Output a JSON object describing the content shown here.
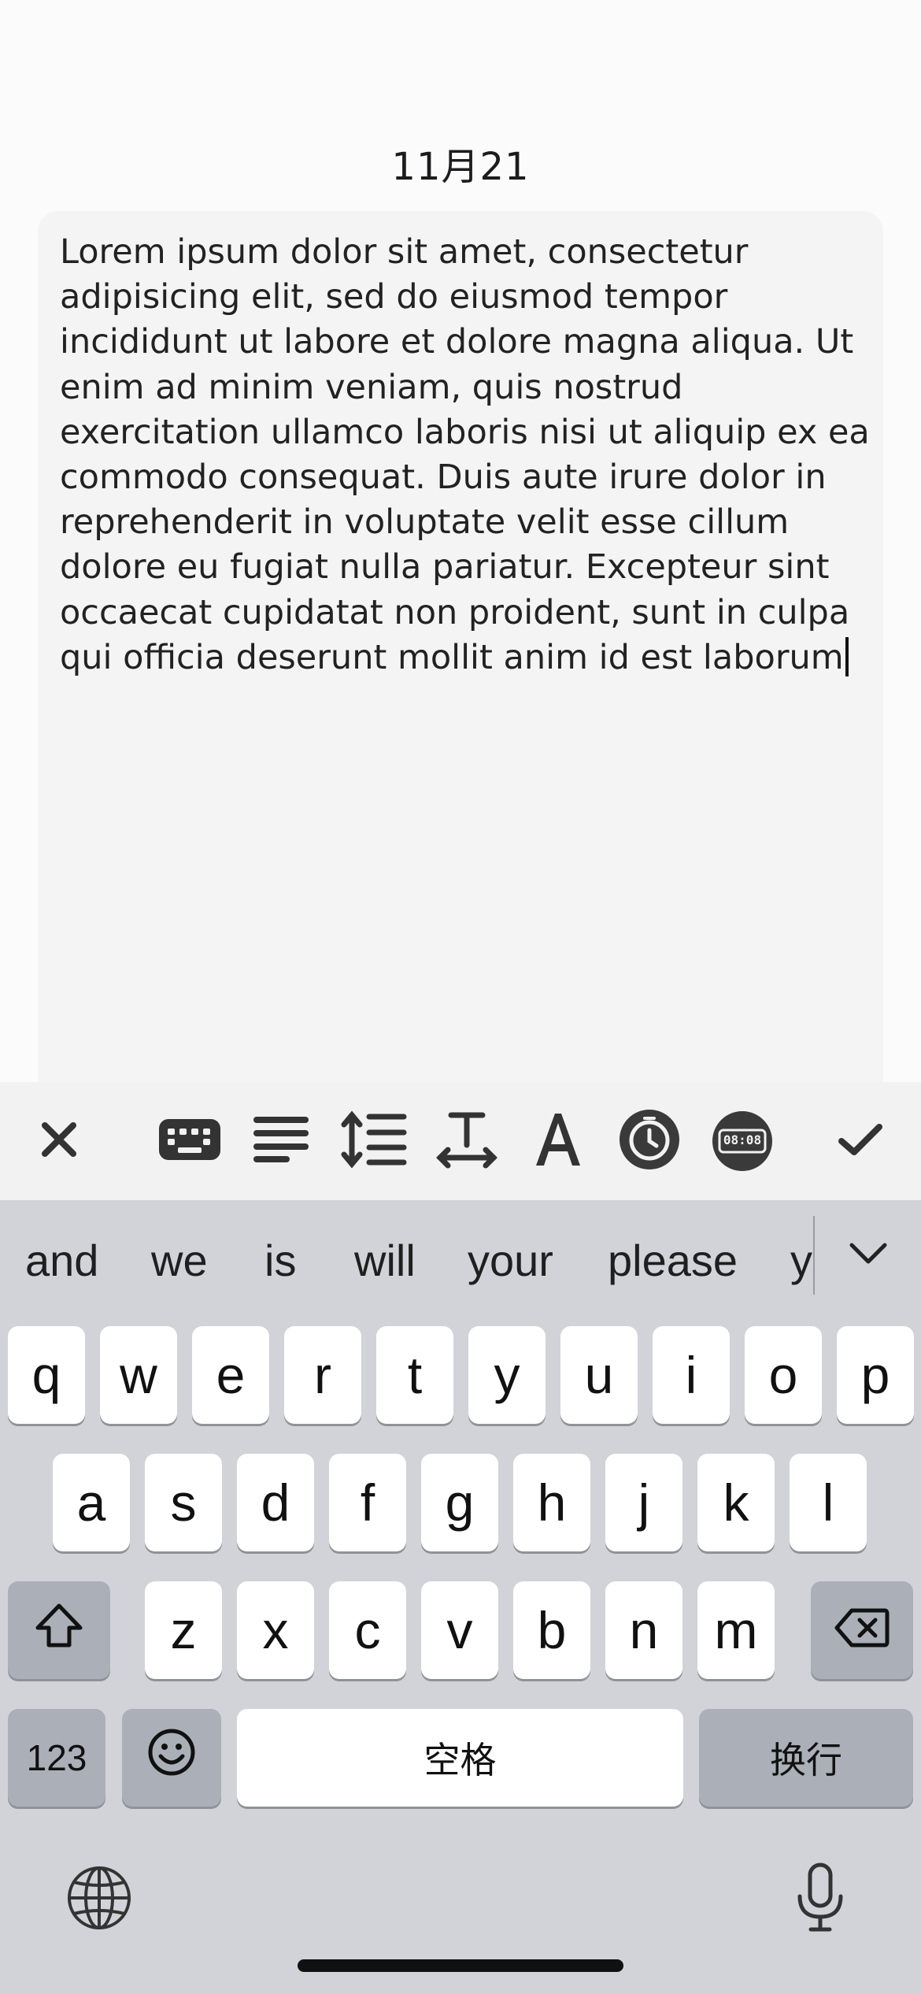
{
  "header": {
    "date": "11月21"
  },
  "note": {
    "text": "Lorem ipsum dolor sit amet, consectetur adipisicing elit, sed do eiusmod tempor incididunt ut labore et dolore magna aliqua. Ut enim ad minim veniam, quis nostrud exercitation ullamco laboris nisi ut aliquip ex ea commodo consequat. Duis aute irure dolor in reprehenderit in voluptate velit esse cillum dolore eu fugiat nulla pariatur. Excepteur sint occaecat cupidatat non proident, sunt in culpa qui officia deserunt mollit anim id est laborum"
  },
  "toolbar": {
    "timer_label": "08:08",
    "icons": [
      "close-icon",
      "keyboard-icon",
      "align-left-icon",
      "line-spacing-icon",
      "text-size-icon",
      "font-icon",
      "clock-icon",
      "digital-clock-icon",
      "checkmark-icon"
    ]
  },
  "keyboard": {
    "suggestions": [
      "and",
      "we",
      "is",
      "will",
      "your",
      "please",
      "y"
    ],
    "row1": [
      "q",
      "w",
      "e",
      "r",
      "t",
      "y",
      "u",
      "i",
      "o",
      "p"
    ],
    "row2": [
      "a",
      "s",
      "d",
      "f",
      "g",
      "h",
      "j",
      "k",
      "l"
    ],
    "row3": [
      "z",
      "x",
      "c",
      "v",
      "b",
      "n",
      "m"
    ],
    "numbers_label": "123",
    "space_label": "空格",
    "return_label": "换行"
  },
  "colors": {
    "background": "#fbfbfb",
    "card": "#f4f4f4",
    "toolbar": "#f2f2f2",
    "keyboard": "#d1d3d9",
    "key": "#ffffff",
    "function_key": "#abafb8"
  }
}
